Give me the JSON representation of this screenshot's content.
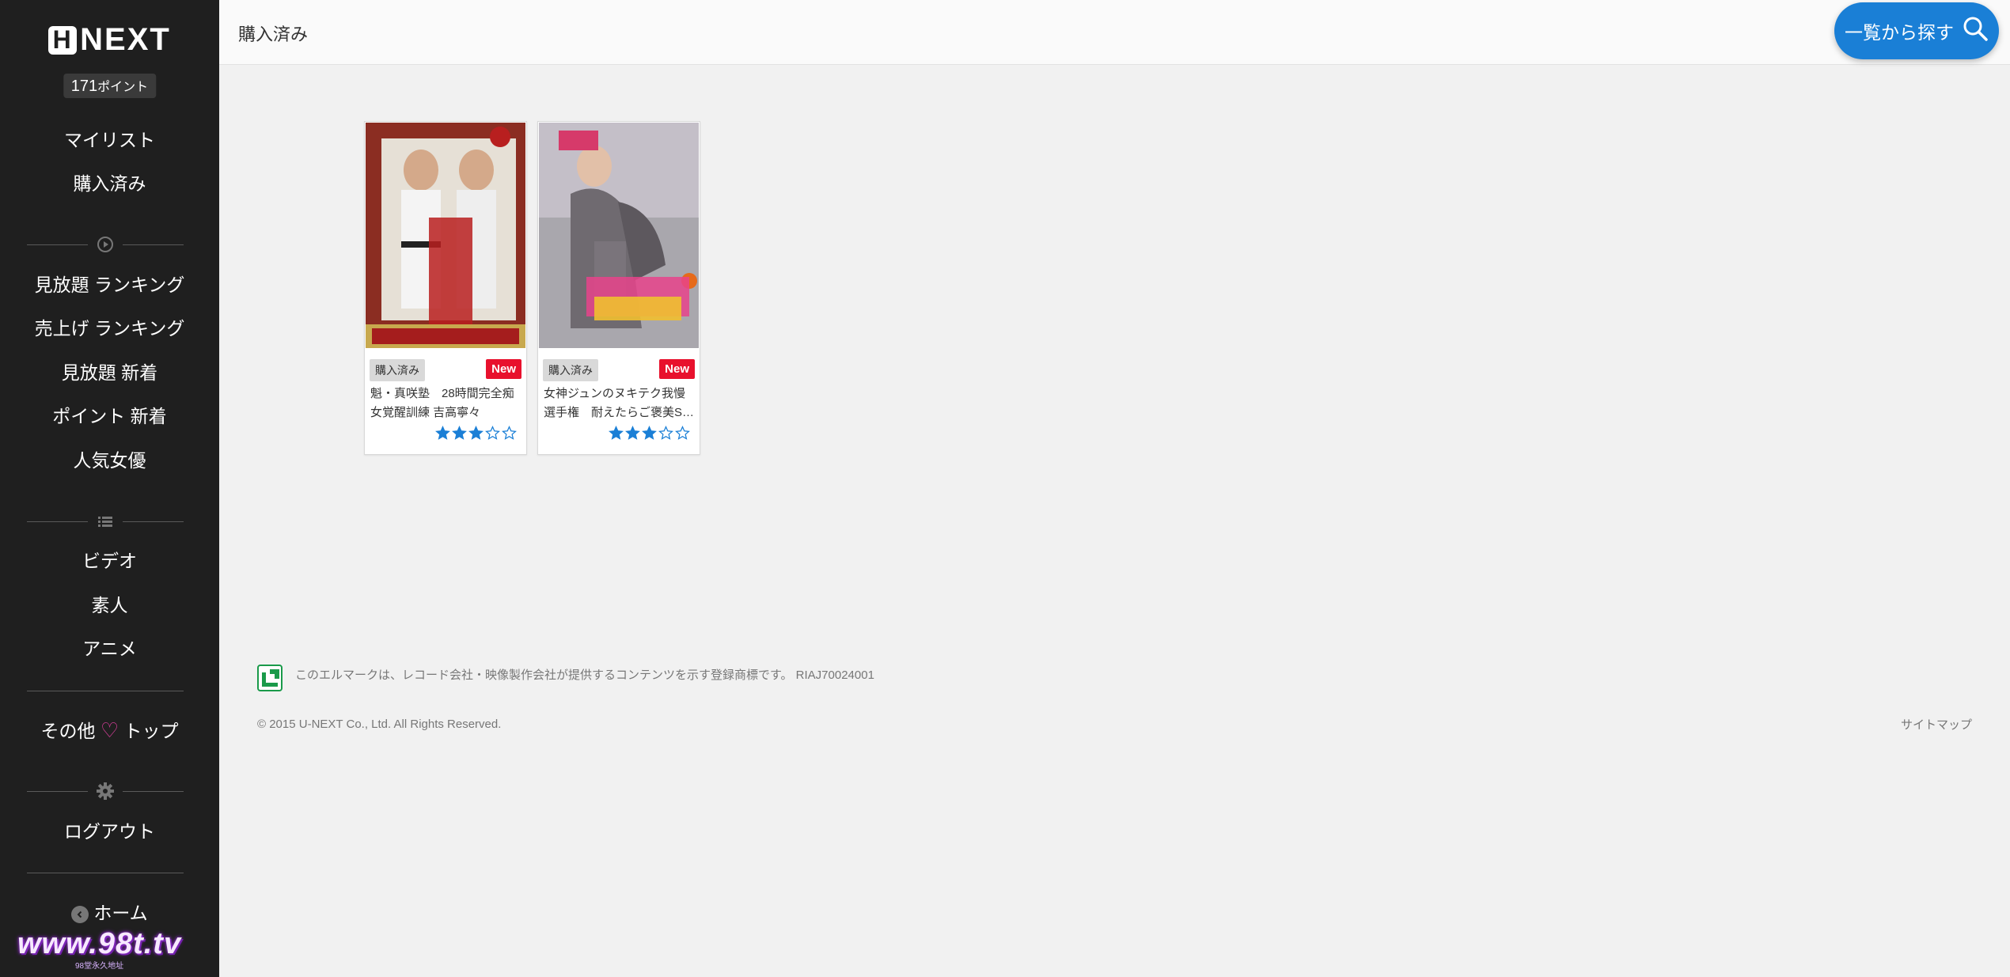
{
  "sidebar": {
    "logo_letter": "H",
    "logo_text": "NEXT",
    "points_value": "171",
    "points_unit": "ポイント",
    "items": {
      "mylist": "マイリスト",
      "purchased": "購入済み",
      "unlimited_ranking": "見放題 ランキング",
      "sales_ranking": "売上げ ランキング",
      "unlimited_new": "見放題 新着",
      "points_new": "ポイント 新着",
      "popular_actress": "人気女優",
      "video": "ビデオ",
      "amateur": "素人",
      "anime": "アニメ",
      "other_prefix": "その他",
      "other_suffix": "トップ",
      "logout": "ログアウト",
      "home": "ホーム"
    },
    "watermark": "www.98t.tv",
    "watermark_sub": "98堂永久地址"
  },
  "header": {
    "title": "購入済み",
    "search_label": "一覧から探す"
  },
  "cards": [
    {
      "purchased_badge": "購入済み",
      "new_badge": "New",
      "title": "魁・真咲塾　28時間完全痴女覚醒訓練 吉高寧々",
      "rating": 3,
      "max_rating": 5
    },
    {
      "purchased_badge": "購入済み",
      "new_badge": "New",
      "title": "女神ジュンのヌキテク我慢選手権　耐えたらご褒美S…",
      "rating": 3,
      "max_rating": 5
    }
  ],
  "footer": {
    "note": "このエルマークは、レコード会社・映像製作会社が提供するコンテンツを示す登録商標です。 RIAJ70024001",
    "copyright": "© 2015 U-NEXT Co., Ltd. All Rights Reserved.",
    "sitemap": "サイトマップ"
  },
  "colors": {
    "sidebar_bg": "#1f1f1f",
    "accent_blue": "#1a7fd6",
    "new_red": "#e8112d",
    "star_blue": "#1a7fd6",
    "heart_pink": "#e040a0"
  }
}
